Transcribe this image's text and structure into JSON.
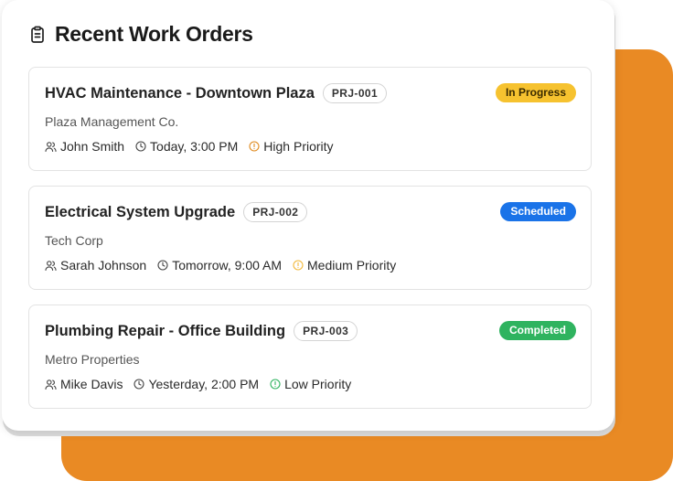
{
  "panel": {
    "title": "Recent Work Orders",
    "title_icon": "clipboard-icon"
  },
  "colors": {
    "backdrop": "#e98a24",
    "in_progress": "#f6c22f",
    "scheduled": "#1a73e8",
    "completed": "#2fb35f",
    "high_priority": "#e08a1e",
    "medium_priority": "#f2b93b",
    "low_priority": "#2fb35f"
  },
  "orders": [
    {
      "title": "HVAC Maintenance - Downtown Plaza",
      "project_id": "PRJ-001",
      "status": "In Progress",
      "client": "Plaza Management Co.",
      "assignee": "John Smith",
      "time": "Today, 3:00 PM",
      "priority": "High Priority"
    },
    {
      "title": "Electrical System Upgrade",
      "project_id": "PRJ-002",
      "status": "Scheduled",
      "client": "Tech Corp",
      "assignee": "Sarah Johnson",
      "time": "Tomorrow, 9:00 AM",
      "priority": "Medium Priority"
    },
    {
      "title": "Plumbing Repair - Office Building",
      "project_id": "PRJ-003",
      "status": "Completed",
      "client": "Metro Properties",
      "assignee": "Mike Davis",
      "time": "Yesterday, 2:00 PM",
      "priority": "Low Priority"
    }
  ]
}
